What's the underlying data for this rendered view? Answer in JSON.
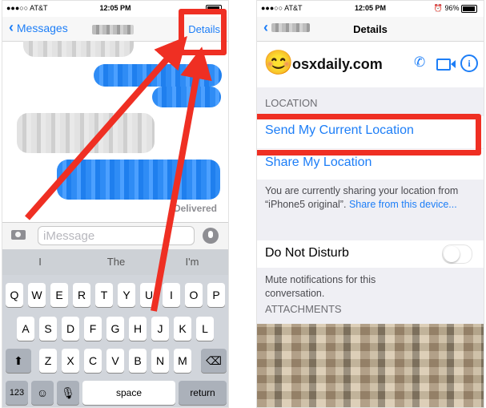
{
  "left": {
    "status": {
      "carrier": "●●●○○ AT&T",
      "time": "12:05 PM"
    },
    "nav": {
      "back_label": "Messages",
      "details_label": "Details"
    },
    "delivered": "Delivered",
    "composer": {
      "placeholder": "iMessage"
    },
    "suggestions": [
      "I",
      "The",
      "I'm"
    ],
    "keyboard": {
      "row1": [
        "Q",
        "W",
        "E",
        "R",
        "T",
        "Y",
        "U",
        "I",
        "O",
        "P"
      ],
      "row2": [
        "A",
        "S",
        "D",
        "F",
        "G",
        "H",
        "J",
        "K",
        "L"
      ],
      "row3": [
        "Z",
        "X",
        "C",
        "V",
        "B",
        "N",
        "M"
      ],
      "numbers_label": "123",
      "space_label": "space",
      "return_label": "return"
    }
  },
  "right": {
    "status": {
      "carrier": "●●●○○ AT&T",
      "time": "12:05 PM",
      "battery": "96%"
    },
    "nav": {
      "title": "Details"
    },
    "contact": {
      "name": "osxdaily.com",
      "avatar": "😊"
    },
    "location_header": "LOCATION",
    "send_location": "Send My Current Location",
    "share_location": "Share My Location",
    "sharing_text": "You are currently sharing your location from “iPhone5 original”.",
    "sharing_link": "Share from this device...",
    "dnd_label": "Do Not Disturb",
    "dnd_on": false,
    "mute_text": "Mute notifications for this conversation.",
    "attachments_header": "ATTACHMENTS"
  },
  "colors": {
    "ios_blue": "#1d7ef7",
    "annotation_red": "#ef2f23",
    "bubble_blue": "#2f8cf5"
  },
  "icons": [
    "back-chevron-icon",
    "camera-icon",
    "microphone-icon",
    "shift-icon",
    "delete-icon",
    "emoji-icon",
    "phone-icon",
    "facetime-icon",
    "info-icon",
    "alarm-icon"
  ]
}
